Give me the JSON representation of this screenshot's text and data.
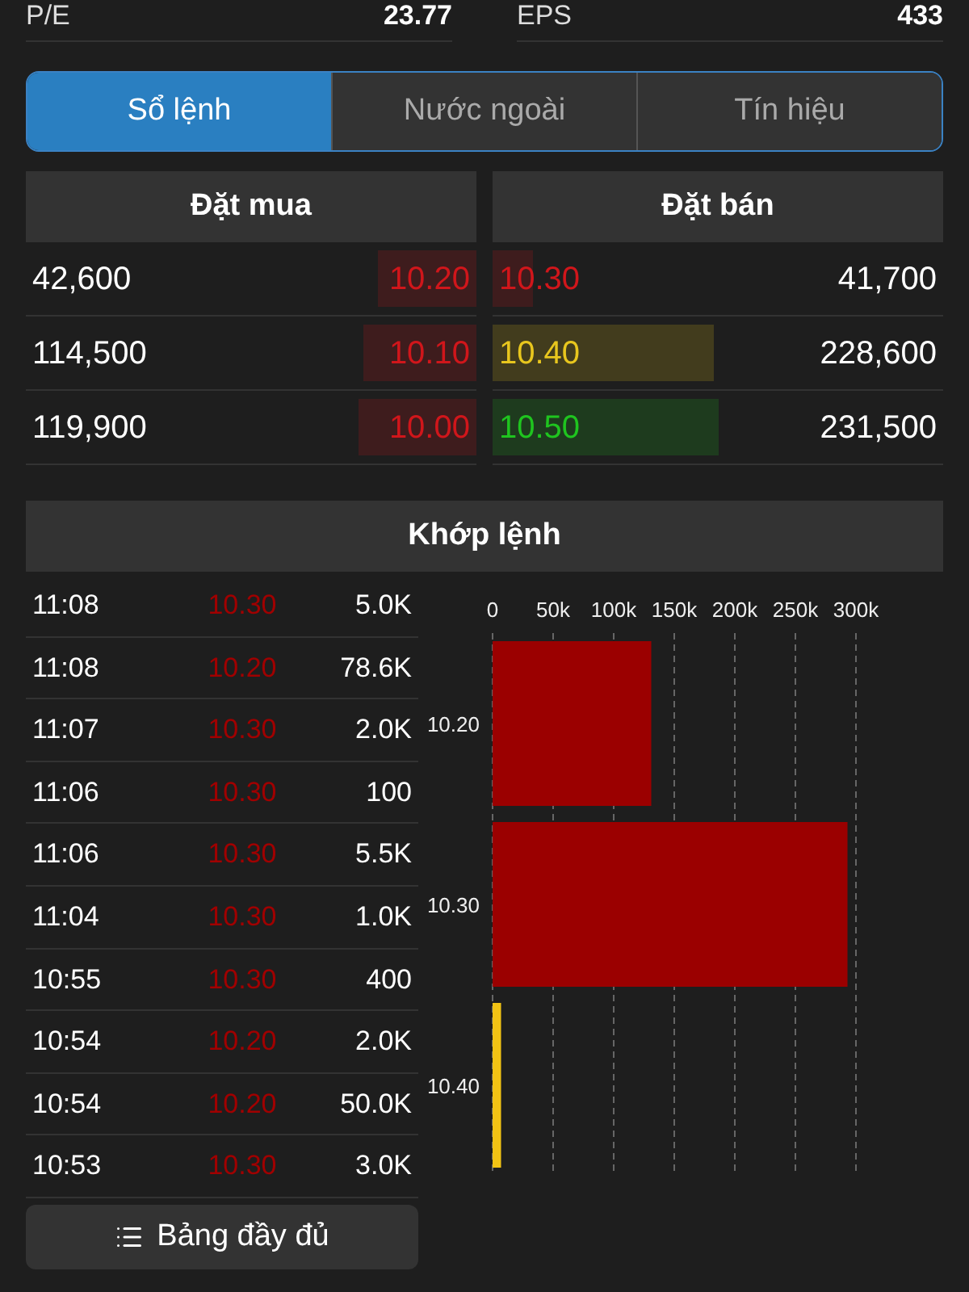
{
  "stats": [
    {
      "label": "P/E",
      "value": "23.77"
    },
    {
      "label": "EPS",
      "value": "433"
    }
  ],
  "tabs": [
    {
      "label": "Sổ lệnh",
      "selected": true
    },
    {
      "label": "Nước ngoài",
      "selected": false
    },
    {
      "label": "Tín hiệu",
      "selected": false
    }
  ],
  "order_book": {
    "bid_title": "Đặt mua",
    "ask_title": "Đặt bán",
    "bids": [
      {
        "volume": "42,600",
        "price": "10.20",
        "color": "#d0161b",
        "level": 0.22
      },
      {
        "volume": "114,500",
        "price": "10.10",
        "color": "#d0161b",
        "level": 0.25
      },
      {
        "volume": "119,900",
        "price": "10.00",
        "color": "#d0161b",
        "level": 0.26
      }
    ],
    "asks": [
      {
        "price": "10.30",
        "volume": "41,700",
        "color": "#d0161b",
        "level": 0.09
      },
      {
        "price": "10.40",
        "volume": "228,600",
        "color": "#e8c61e",
        "level": 0.49
      },
      {
        "price": "10.50",
        "volume": "231,500",
        "color": "#1fc41f",
        "level": 0.5
      }
    ]
  },
  "matches": {
    "title": "Khớp lệnh",
    "rows": [
      {
        "time": "11:08",
        "price": "10.30",
        "volume": "5.0K"
      },
      {
        "time": "11:08",
        "price": "10.20",
        "volume": "78.6K"
      },
      {
        "time": "11:07",
        "price": "10.30",
        "volume": "2.0K"
      },
      {
        "time": "11:06",
        "price": "10.30",
        "volume": "100"
      },
      {
        "time": "11:06",
        "price": "10.30",
        "volume": "5.5K"
      },
      {
        "time": "11:04",
        "price": "10.30",
        "volume": "1.0K"
      },
      {
        "time": "10:55",
        "price": "10.30",
        "volume": "400"
      },
      {
        "time": "10:54",
        "price": "10.20",
        "volume": "2.0K"
      },
      {
        "time": "10:54",
        "price": "10.20",
        "volume": "50.0K"
      },
      {
        "time": "10:53",
        "price": "10.30",
        "volume": "3.0K"
      }
    ],
    "full_table_button": "Bảng đầy đủ",
    "chart_data": {
      "type": "bar",
      "orientation": "horizontal",
      "categories": [
        "10.20",
        "10.30",
        "10.40"
      ],
      "series": [
        {
          "color": "#9b0000",
          "values": [
            131000,
            293000,
            null
          ]
        },
        {
          "color": "#f2c314",
          "values": [
            null,
            null,
            7000
          ]
        }
      ],
      "grid": true,
      "xlim": [
        0,
        300000
      ],
      "xticks": [
        {
          "value": 0,
          "label": "0"
        },
        {
          "value": 50000,
          "label": "50k"
        },
        {
          "value": 100000,
          "label": "100k"
        },
        {
          "value": 150000,
          "label": "150k"
        },
        {
          "value": 200000,
          "label": "200k"
        },
        {
          "value": 250000,
          "label": "250k"
        },
        {
          "value": 300000,
          "label": "300k"
        }
      ]
    }
  }
}
